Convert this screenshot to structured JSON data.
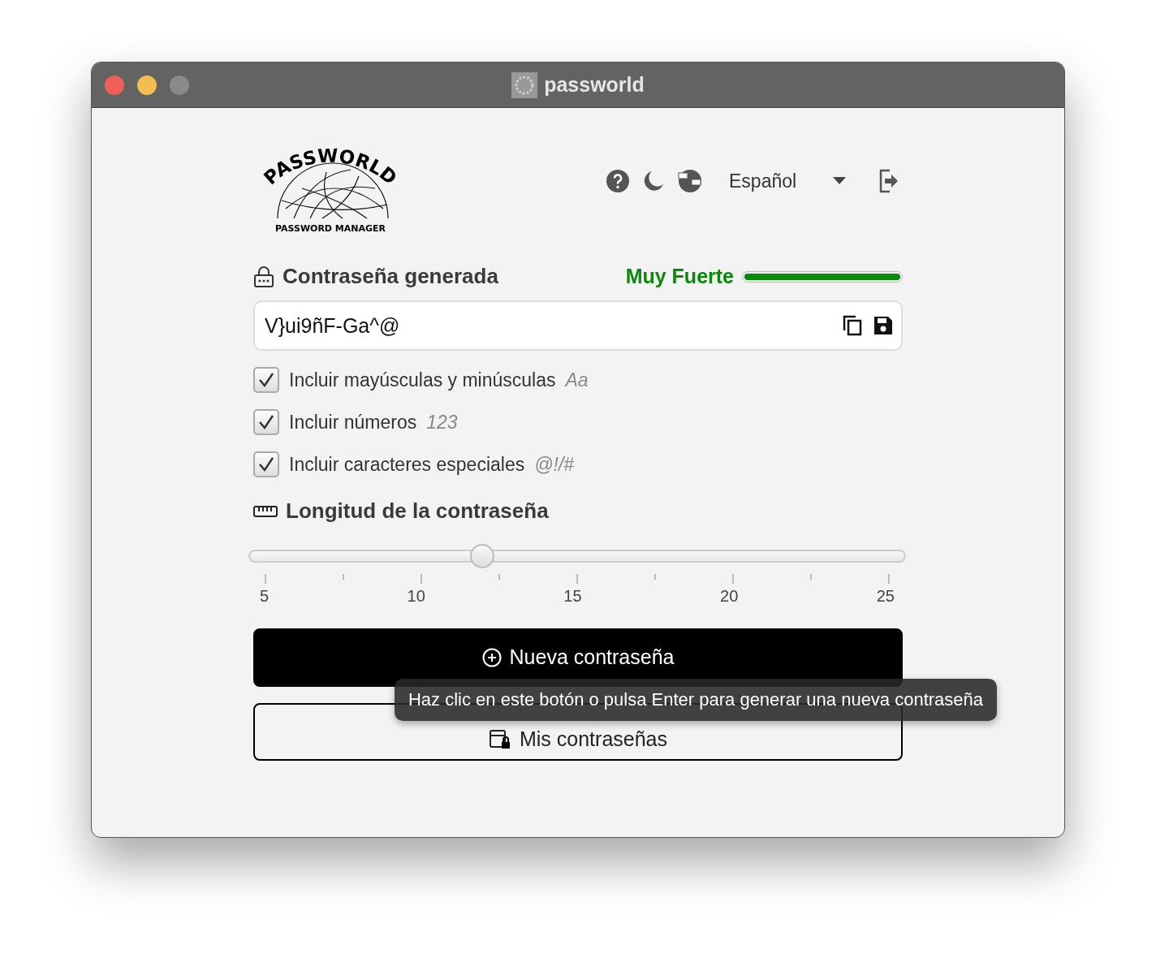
{
  "window": {
    "title": "passworld"
  },
  "logo": {
    "title": "PASSWORLD",
    "subtitle": "PASSWORD MANAGER"
  },
  "toolbar": {
    "language": "Español"
  },
  "password": {
    "heading": "Contraseña generada",
    "strength_label": "Muy Fuerte",
    "strength": {
      "level": 1
    },
    "value": "V}ui9ñF-Ga^@"
  },
  "options": [
    {
      "label": "Incluir mayúsculas y minúsculas",
      "hint": "Aa",
      "checked": true
    },
    {
      "label": "Incluir números",
      "hint": "123",
      "checked": true
    },
    {
      "label": "Incluir caracteres especiales",
      "hint": "@!/#",
      "checked": true
    }
  ],
  "length": {
    "heading": "Longitud de la contraseña",
    "level": 0.35,
    "ticks": [
      "5",
      "10",
      "15",
      "20",
      "25"
    ]
  },
  "buttons": [
    {
      "label": "Nueva contraseña",
      "kind": "primary"
    },
    {
      "label": "Mis contraseñas",
      "kind": "outline"
    }
  ],
  "tooltip": {
    "text": "Haz clic en este botón o pulsa Enter para generar una nueva contraseña"
  }
}
